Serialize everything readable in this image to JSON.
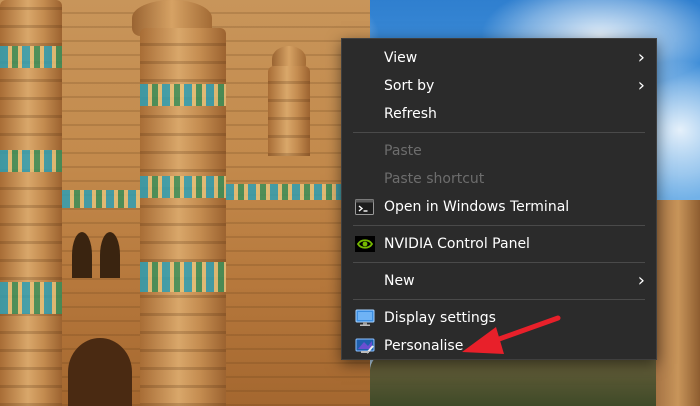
{
  "context_menu": {
    "view": "View",
    "sort_by": "Sort by",
    "refresh": "Refresh",
    "paste": "Paste",
    "paste_shortcut": "Paste shortcut",
    "open_terminal": "Open in Windows Terminal",
    "nvidia_panel": "NVIDIA Control Panel",
    "new": "New",
    "display_settings": "Display settings",
    "personalise": "Personalise"
  },
  "icons": {
    "terminal": "terminal-icon",
    "nvidia": "nvidia-icon",
    "display": "display-settings-icon",
    "personalise": "personalise-icon",
    "submenu": "chevron-right-icon"
  },
  "colors": {
    "menu_bg": "#2b2b2b",
    "menu_text": "#ffffff",
    "disabled_text": "#6d6d6d",
    "annotation_arrow": "#e8202a"
  }
}
